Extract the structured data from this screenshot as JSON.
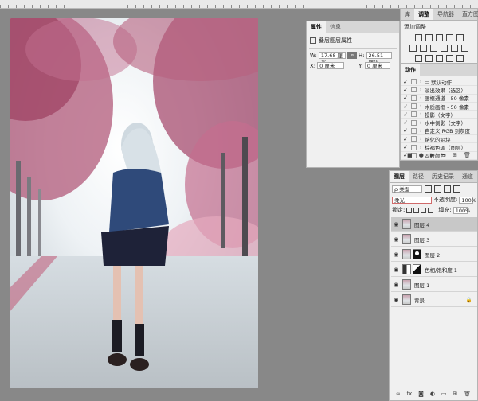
{
  "canvas": {
    "description_icon": "photo-canvas"
  },
  "properties_panel": {
    "tabs": [
      "属性",
      "信息"
    ],
    "title": "叠层图层属性",
    "w_label": "W:",
    "w_value": "17.68 厘米",
    "h_label": "H:",
    "h_value": "26.51 厘米",
    "x_label": "X:",
    "x_value": "0 厘米",
    "y_label": "Y:",
    "y_value": "0 厘米",
    "link_icon": "link-icon"
  },
  "adjustments_panel": {
    "tabs": [
      "库",
      "调整",
      "导航器",
      "直方图"
    ],
    "title": "添加调整",
    "row1_icons": [
      "brightness-icon",
      "levels-icon",
      "curves-icon",
      "exposure-icon",
      "vibrance-icon"
    ],
    "row2_icons": [
      "hue-icon",
      "balance-icon",
      "bw-icon",
      "photo-filter-icon",
      "channel-mixer-icon",
      "lookup-icon"
    ],
    "row3_icons": [
      "invert-icon",
      "posterize-icon",
      "threshold-icon",
      "gradient-map-icon",
      "selective-color-icon"
    ]
  },
  "actions_panel": {
    "tab": "动作",
    "rows": [
      {
        "check": "✓",
        "label": "默认动作",
        "folder": true
      },
      {
        "check": "✓",
        "label": "淡出效果（选区）"
      },
      {
        "check": "✓",
        "label": "画框通道 - 50 像素"
      },
      {
        "check": "✓",
        "label": "木质画框 - 50 像素"
      },
      {
        "check": "✓",
        "label": "投影（文字）"
      },
      {
        "check": "✓",
        "label": "水中倒影（文字）"
      },
      {
        "check": "✓",
        "label": "自定义 RGB 到灰度"
      },
      {
        "check": "✓",
        "label": "熔化的铅块"
      },
      {
        "check": "✓",
        "label": "棕褐色调（图层）"
      },
      {
        "check": "✓",
        "label": "四分颜色"
      }
    ]
  },
  "layers_panel": {
    "tabs": [
      "图层",
      "路径",
      "历史记录",
      "通道"
    ],
    "filter_label": "ρ 类型",
    "blend_mode": "柔光",
    "opacity_label": "不透明度:",
    "opacity_value": "100%",
    "lock_label": "锁定:",
    "fill_label": "填充:",
    "fill_value": "100%",
    "layers": [
      {
        "name": "图层 4",
        "selected": true,
        "mask": false
      },
      {
        "name": "图层 3",
        "selected": false,
        "mask": false
      },
      {
        "name": "图层 2",
        "selected": false,
        "mask": true
      },
      {
        "name": "色相/饱和度 1",
        "selected": false,
        "adjust": true
      },
      {
        "name": "图层 1",
        "selected": false,
        "mask": false
      },
      {
        "name": "背景",
        "selected": false,
        "mask": false,
        "locked": true
      }
    ],
    "footer_fx": "fx"
  },
  "accent": "#c8c8c8"
}
